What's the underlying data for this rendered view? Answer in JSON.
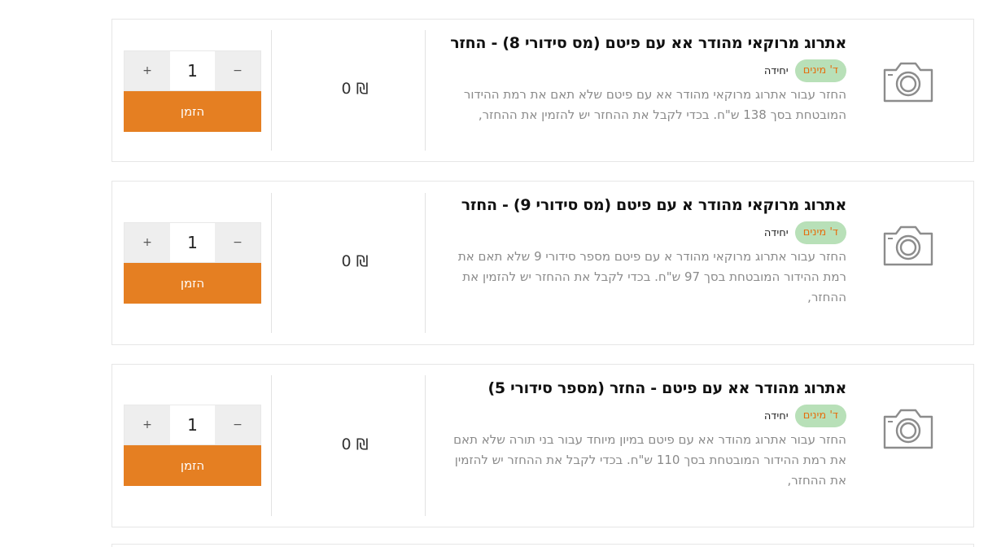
{
  "products": [
    {
      "title": "אתרוג מרוקאי מהודר אא עם פיטם (מס סידורי 8) - החזר",
      "badge": "ד' מינים",
      "unit": "יחידה",
      "description": "החזר עבור אתרוג מרוקאי מהודר אא עם פיטם שלא תאם את רמת ההידור המובטחת בסך 138 ש\"ח. בכדי לקבל את ההחזר יש להזמין את ההחזר,",
      "price": "0 ₪",
      "quantity": "1",
      "minus_label": "−",
      "plus_label": "+",
      "order_label": "הזמן"
    },
    {
      "title": "אתרוג מרוקאי מהודר א עם פיטם (מס סידורי 9) - החזר",
      "badge": "ד' מינים",
      "unit": "יחידה",
      "description": "החזר עבור אתרוג מרוקאי מהודר א עם פיטם מספר סידורי 9 שלא תאם את רמת ההידור המובטחת בסך 97 ש\"ח. בכדי לקבל את ההחזר יש להזמין את ההחזר,",
      "price": "0 ₪",
      "quantity": "1",
      "minus_label": "−",
      "plus_label": "+",
      "order_label": "הזמן"
    },
    {
      "title": "אתרוג מהודר אא עם פיטם - החזר (מספר סידורי 5)",
      "badge": "ד' מינים",
      "unit": "יחידה",
      "description": "החזר עבור אתרוג מהודר אא עם פיטם במיון מיוחד עבור בני תורה שלא תאם את רמת ההידור המובטחת בסך 110 ש\"ח. בכדי לקבל את ההחזר יש להזמין את ההחזר,",
      "price": "0 ₪",
      "quantity": "1",
      "minus_label": "−",
      "plus_label": "+",
      "order_label": "הזמן"
    }
  ],
  "icons": {
    "product_image": "camera-icon"
  },
  "colors": {
    "accent": "#e57f22",
    "badge_bg": "#b8e0b8",
    "badge_text": "#e56e0f"
  }
}
